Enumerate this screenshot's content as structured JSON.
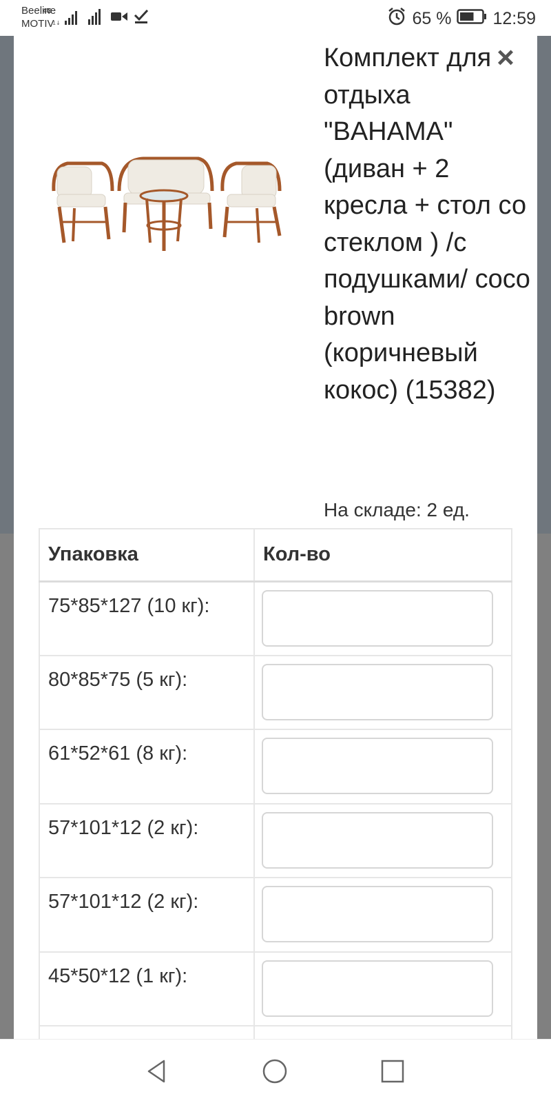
{
  "status_bar": {
    "carrier_line1": "Beeline",
    "carrier_line2": "MOTIV",
    "network_type": "4G",
    "battery_percent": "65 %",
    "battery_level": 0.65,
    "time": "12:59",
    "icons": [
      "signal-icon",
      "signal-icon",
      "video-call-icon",
      "download-done-icon",
      "alarm-icon",
      "battery-icon"
    ]
  },
  "modal": {
    "close_symbol": "×",
    "product_title": "Комплект для отдыха \"BAHAMA\" (диван + 2 кресла + стол со стеклом ) /с подушками/ coco brown (коричневый кокос) (15382)",
    "stock": "На складе: 2 ед.",
    "table": {
      "headers": [
        "Упаковка",
        "Кол-во"
      ],
      "rows": [
        {
          "pack": "75*85*127 (10 кг):",
          "qty": ""
        },
        {
          "pack": "80*85*75 (5 кг):",
          "qty": ""
        },
        {
          "pack": "61*52*61 (8 кг):",
          "qty": ""
        },
        {
          "pack": "57*101*12 (2 кг):",
          "qty": ""
        },
        {
          "pack": "57*101*12 (2 кг):",
          "qty": ""
        },
        {
          "pack": "45*50*12 (1 кг):",
          "qty": ""
        }
      ]
    }
  },
  "nav_bar": {
    "icons": [
      "back-triangle-icon",
      "home-circle-icon",
      "recent-square-icon"
    ]
  },
  "colors": {
    "backdrop_top": "#6f767d",
    "backdrop_bottom": "#808080",
    "rattan_brown": "#a5582a",
    "cushion": "#efebe3"
  }
}
